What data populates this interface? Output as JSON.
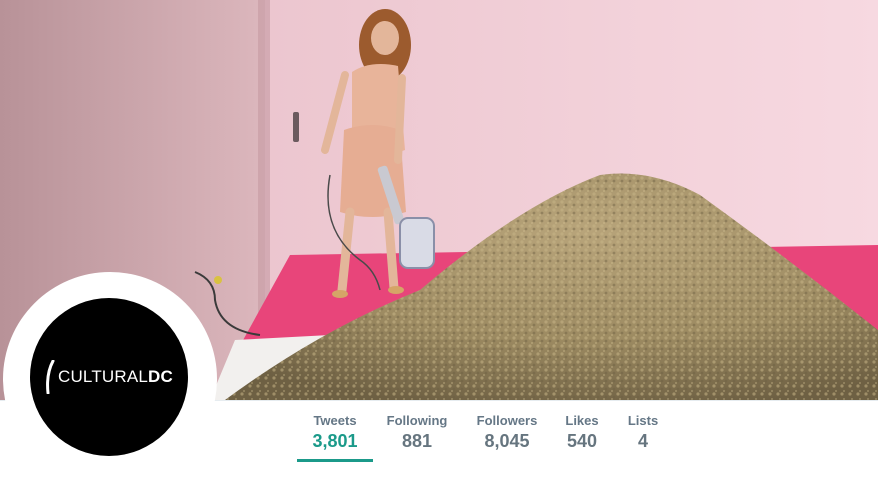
{
  "profile": {
    "avatar_text_light": "CULTURAL",
    "avatar_text_bold": "DC",
    "header_photo": "installation-photo"
  },
  "stats": [
    {
      "label": "Tweets",
      "value": "3,801",
      "active": true
    },
    {
      "label": "Following",
      "value": "881",
      "active": false
    },
    {
      "label": "Followers",
      "value": "8,045",
      "active": false
    },
    {
      "label": "Likes",
      "value": "540",
      "active": false
    },
    {
      "label": "Lists",
      "value": "4",
      "active": false
    }
  ],
  "colors": {
    "accent": "#1b9a8a",
    "label": "#657786",
    "carpet": "#e8457a"
  }
}
